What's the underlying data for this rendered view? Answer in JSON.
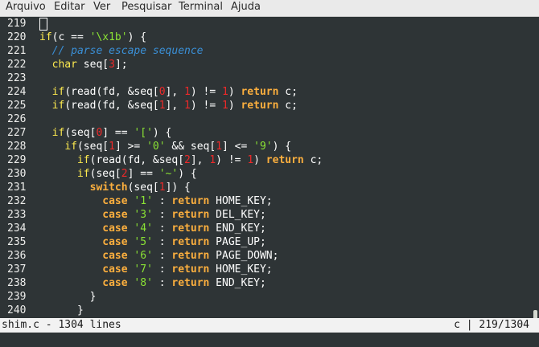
{
  "menu": [
    "Arquivo",
    "Editar",
    "Ver",
    "Pesquisar",
    "Terminal",
    "Ajuda"
  ],
  "lines": [
    {
      "n": "219",
      "code": []
    },
    {
      "n": "220",
      "code": [
        [
          "kw",
          "if"
        ],
        [
          "t",
          "(c == "
        ],
        [
          "str",
          "'\\x1b'"
        ],
        [
          "t",
          ") {"
        ]
      ]
    },
    {
      "n": "221",
      "code": [
        [
          "t",
          "  "
        ],
        [
          "cmt",
          "// parse escape sequence"
        ]
      ]
    },
    {
      "n": "222",
      "code": [
        [
          "t",
          "  "
        ],
        [
          "type",
          "char"
        ],
        [
          "t",
          " seq["
        ],
        [
          "num",
          "3"
        ],
        [
          "t",
          "];"
        ]
      ]
    },
    {
      "n": "223",
      "code": []
    },
    {
      "n": "224",
      "code": [
        [
          "t",
          "  "
        ],
        [
          "kw",
          "if"
        ],
        [
          "t",
          "(read(fd, &seq["
        ],
        [
          "num",
          "0"
        ],
        [
          "t",
          "], "
        ],
        [
          "num",
          "1"
        ],
        [
          "t",
          ") != "
        ],
        [
          "num",
          "1"
        ],
        [
          "t",
          ") "
        ],
        [
          "ret",
          "return"
        ],
        [
          "t",
          " c;"
        ]
      ]
    },
    {
      "n": "225",
      "code": [
        [
          "t",
          "  "
        ],
        [
          "kw",
          "if"
        ],
        [
          "t",
          "(read(fd, &seq["
        ],
        [
          "num",
          "1"
        ],
        [
          "t",
          "], "
        ],
        [
          "num",
          "1"
        ],
        [
          "t",
          ") != "
        ],
        [
          "num",
          "1"
        ],
        [
          "t",
          ") "
        ],
        [
          "ret",
          "return"
        ],
        [
          "t",
          " c;"
        ]
      ]
    },
    {
      "n": "226",
      "code": []
    },
    {
      "n": "227",
      "code": [
        [
          "t",
          "  "
        ],
        [
          "kw",
          "if"
        ],
        [
          "t",
          "(seq["
        ],
        [
          "num",
          "0"
        ],
        [
          "t",
          "] == "
        ],
        [
          "str",
          "'['"
        ],
        [
          "t",
          ") {"
        ]
      ]
    },
    {
      "n": "228",
      "code": [
        [
          "t",
          "    "
        ],
        [
          "kw",
          "if"
        ],
        [
          "t",
          "(seq["
        ],
        [
          "num",
          "1"
        ],
        [
          "t",
          "] >= "
        ],
        [
          "str",
          "'0'"
        ],
        [
          "t",
          " && seq["
        ],
        [
          "num",
          "1"
        ],
        [
          "t",
          "] <= "
        ],
        [
          "str",
          "'9'"
        ],
        [
          "t",
          ") {"
        ]
      ]
    },
    {
      "n": "229",
      "code": [
        [
          "t",
          "      "
        ],
        [
          "kw",
          "if"
        ],
        [
          "t",
          "(read(fd, &seq["
        ],
        [
          "num",
          "2"
        ],
        [
          "t",
          "], "
        ],
        [
          "num",
          "1"
        ],
        [
          "t",
          ") != "
        ],
        [
          "num",
          "1"
        ],
        [
          "t",
          ") "
        ],
        [
          "ret",
          "return"
        ],
        [
          "t",
          " c;"
        ]
      ]
    },
    {
      "n": "230",
      "code": [
        [
          "t",
          "      "
        ],
        [
          "kw",
          "if"
        ],
        [
          "t",
          "(seq["
        ],
        [
          "num",
          "2"
        ],
        [
          "t",
          "] == "
        ],
        [
          "str",
          "'~'"
        ],
        [
          "t",
          ") {"
        ]
      ]
    },
    {
      "n": "231",
      "code": [
        [
          "t",
          "        "
        ],
        [
          "ret",
          "switch"
        ],
        [
          "t",
          "(seq["
        ],
        [
          "num",
          "1"
        ],
        [
          "t",
          "]) {"
        ]
      ]
    },
    {
      "n": "232",
      "code": [
        [
          "t",
          "          "
        ],
        [
          "ret",
          "case"
        ],
        [
          "t",
          " "
        ],
        [
          "str",
          "'1'"
        ],
        [
          "t",
          " : "
        ],
        [
          "ret",
          "return"
        ],
        [
          "t",
          " HOME_KEY;"
        ]
      ]
    },
    {
      "n": "233",
      "code": [
        [
          "t",
          "          "
        ],
        [
          "ret",
          "case"
        ],
        [
          "t",
          " "
        ],
        [
          "str",
          "'3'"
        ],
        [
          "t",
          " : "
        ],
        [
          "ret",
          "return"
        ],
        [
          "t",
          " DEL_KEY;"
        ]
      ]
    },
    {
      "n": "234",
      "code": [
        [
          "t",
          "          "
        ],
        [
          "ret",
          "case"
        ],
        [
          "t",
          " "
        ],
        [
          "str",
          "'4'"
        ],
        [
          "t",
          " : "
        ],
        [
          "ret",
          "return"
        ],
        [
          "t",
          " END_KEY;"
        ]
      ]
    },
    {
      "n": "235",
      "code": [
        [
          "t",
          "          "
        ],
        [
          "ret",
          "case"
        ],
        [
          "t",
          " "
        ],
        [
          "str",
          "'5'"
        ],
        [
          "t",
          " : "
        ],
        [
          "ret",
          "return"
        ],
        [
          "t",
          " PAGE_UP;"
        ]
      ]
    },
    {
      "n": "236",
      "code": [
        [
          "t",
          "          "
        ],
        [
          "ret",
          "case"
        ],
        [
          "t",
          " "
        ],
        [
          "str",
          "'6'"
        ],
        [
          "t",
          " : "
        ],
        [
          "ret",
          "return"
        ],
        [
          "t",
          " PAGE_DOWN;"
        ]
      ]
    },
    {
      "n": "237",
      "code": [
        [
          "t",
          "          "
        ],
        [
          "ret",
          "case"
        ],
        [
          "t",
          " "
        ],
        [
          "str",
          "'7'"
        ],
        [
          "t",
          " : "
        ],
        [
          "ret",
          "return"
        ],
        [
          "t",
          " HOME_KEY;"
        ]
      ]
    },
    {
      "n": "238",
      "code": [
        [
          "t",
          "          "
        ],
        [
          "ret",
          "case"
        ],
        [
          "t",
          " "
        ],
        [
          "str",
          "'8'"
        ],
        [
          "t",
          " : "
        ],
        [
          "ret",
          "return"
        ],
        [
          "t",
          " END_KEY;"
        ]
      ]
    },
    {
      "n": "239",
      "code": [
        [
          "t",
          "        }"
        ]
      ]
    },
    {
      "n": "240",
      "code": [
        [
          "t",
          "      }"
        ]
      ]
    }
  ],
  "status": {
    "left": "shim.c - 1304 lines",
    "right": "c | 219/1304"
  },
  "colors": {
    "background": "#2e3436",
    "keyword": "#fce94f",
    "return_keyword": "#fcaf3e",
    "comment": "#3a8fd6",
    "string": "#8ae234",
    "number": "#ef2929",
    "status_bg": "#f2f2f2"
  }
}
